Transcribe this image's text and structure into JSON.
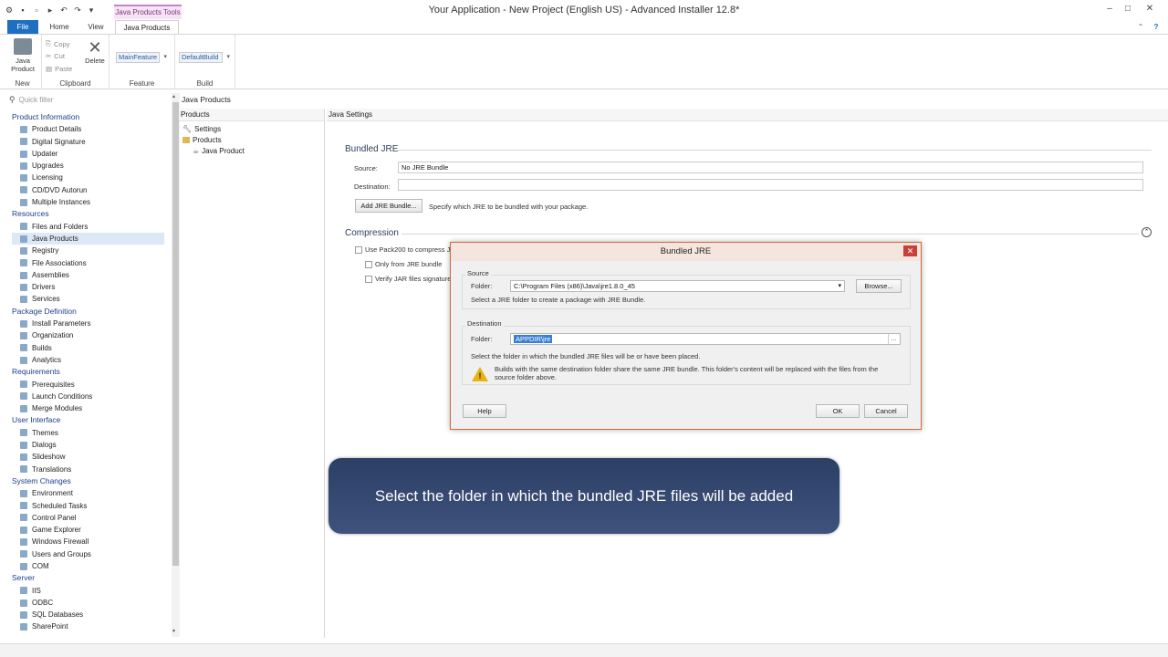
{
  "window": {
    "title": "Your Application - New Project (English US) - Advanced Installer 12.8*",
    "contextual_tab": "Java Products Tools"
  },
  "ribbon": {
    "tabs": [
      "File",
      "Home",
      "View",
      "Java Products"
    ],
    "groups": {
      "new": {
        "label": "New",
        "java_product": "Java\nProduct"
      },
      "clipboard": {
        "label": "Clipboard",
        "copy": "Copy",
        "cut": "Cut",
        "paste": "Paste",
        "delete": "Delete"
      },
      "feature": {
        "label": "Feature",
        "value": "MainFeature"
      },
      "build": {
        "label": "Build",
        "value": "DefaultBuild"
      }
    }
  },
  "nav": {
    "quick_filter_placeholder": "Quick filter",
    "sections": [
      {
        "title": "Product Information",
        "items": [
          "Product Details",
          "Digital Signature",
          "Updater",
          "Upgrades",
          "Licensing",
          "CD/DVD Autorun",
          "Multiple Instances"
        ]
      },
      {
        "title": "Resources",
        "items": [
          "Files and Folders",
          "Java Products",
          "Registry",
          "File Associations",
          "Assemblies",
          "Drivers",
          "Services"
        ]
      },
      {
        "title": "Package Definition",
        "items": [
          "Install Parameters",
          "Organization",
          "Builds",
          "Analytics"
        ]
      },
      {
        "title": "Requirements",
        "items": [
          "Prerequisites",
          "Launch Conditions",
          "Merge Modules"
        ]
      },
      {
        "title": "User Interface",
        "items": [
          "Themes",
          "Dialogs",
          "Slideshow",
          "Translations"
        ]
      },
      {
        "title": "System Changes",
        "items": [
          "Environment",
          "Scheduled Tasks",
          "Control Panel",
          "Game Explorer",
          "Windows Firewall",
          "Users and Groups",
          "COM"
        ]
      },
      {
        "title": "Server",
        "items": [
          "IIS",
          "ODBC",
          "SQL Databases",
          "SharePoint"
        ]
      }
    ],
    "selected": "Java Products"
  },
  "page": {
    "breadcrumb": "Java Products",
    "products_pane": {
      "header": "Products",
      "tree": [
        "Settings",
        "Products",
        "Java Product"
      ]
    },
    "settings_pane": {
      "header": "Java Settings",
      "bundled_jre": {
        "title": "Bundled JRE",
        "source_label": "Source:",
        "source_value": "No JRE Bundle",
        "destination_label": "Destination:",
        "destination_value": "",
        "add_button": "Add JRE Bundle...",
        "hint": "Specify which JRE to be bundled with your package."
      },
      "compression": {
        "title": "Compression",
        "use_pack200": "Use Pack200 to compress JAR",
        "only_from_jre": "Only from JRE bundle",
        "verify_jar": "Verify JAR files signature"
      }
    }
  },
  "dialog": {
    "title": "Bundled JRE",
    "source": {
      "group_title": "Source",
      "folder_label": "Folder:",
      "folder_value": "C:\\Program Files (x86)\\Java\\jre1.8.0_45",
      "browse_button": "Browse...",
      "hint": "Select a JRE folder to create a package with JRE Bundle."
    },
    "destination": {
      "group_title": "Destination",
      "folder_label": "Folder:",
      "folder_value": "APPDIR\\jre",
      "browse_button": "...",
      "hint": "Select the folder in which the bundled JRE files will be or have been placed.",
      "warning": "Builds with the same destination folder share the same JRE bundle. This folder's content will be replaced with the files from the source folder above."
    },
    "help_button": "Help",
    "ok_button": "OK",
    "cancel_button": "Cancel"
  },
  "caption": "Select the folder in which the bundled JRE files will be added"
}
